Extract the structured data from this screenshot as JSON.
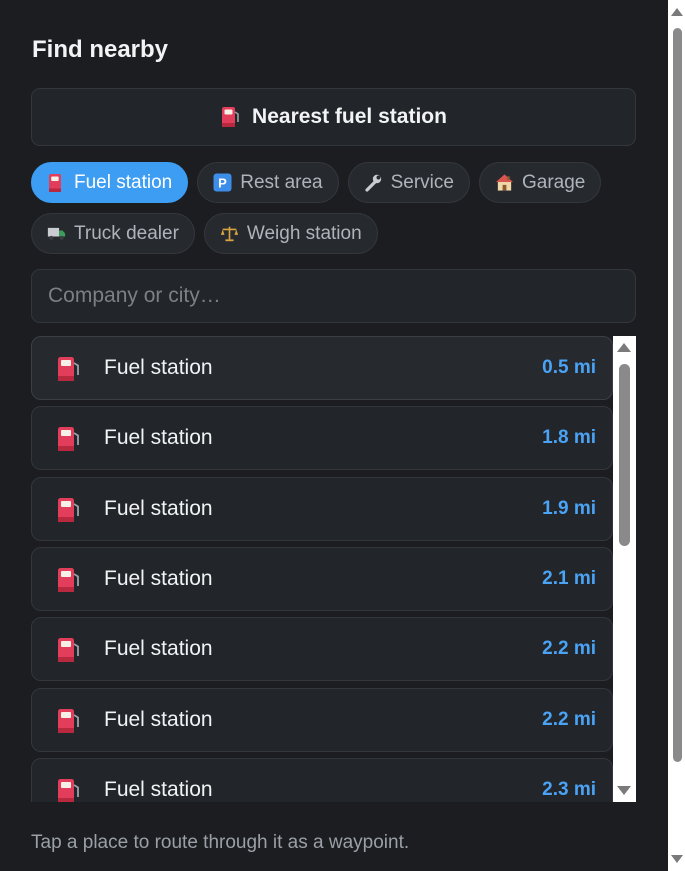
{
  "panel": {
    "title": "Find nearby",
    "nearest_button_label": "Nearest fuel station",
    "nearest_button_icon": "fuel-pump-icon"
  },
  "categories": [
    {
      "label": "Fuel station",
      "icon": "fuel-pump-icon",
      "active": true
    },
    {
      "label": "Rest area",
      "icon": "parking-icon",
      "active": false
    },
    {
      "label": "Service",
      "icon": "wrench-icon",
      "active": false
    },
    {
      "label": "Garage",
      "icon": "house-icon",
      "active": false
    },
    {
      "label": "Truck dealer",
      "icon": "truck-icon",
      "active": false
    },
    {
      "label": "Weigh station",
      "icon": "scales-icon",
      "active": false
    }
  ],
  "search": {
    "placeholder": "Company or city…",
    "value": ""
  },
  "results": [
    {
      "label": "Fuel station",
      "distance": "0.5 mi"
    },
    {
      "label": "Fuel station",
      "distance": "1.8 mi"
    },
    {
      "label": "Fuel station",
      "distance": "1.9 mi"
    },
    {
      "label": "Fuel station",
      "distance": "2.1 mi"
    },
    {
      "label": "Fuel station",
      "distance": "2.2 mi"
    },
    {
      "label": "Fuel station",
      "distance": "2.2 mi"
    },
    {
      "label": "Fuel station",
      "distance": "2.3 mi"
    }
  ],
  "footer": {
    "hint": "Tap a place to route through it as a waypoint."
  },
  "colors": {
    "accent": "#3d9df3",
    "distance": "#4aa3f5",
    "background": "#1b1d21"
  }
}
